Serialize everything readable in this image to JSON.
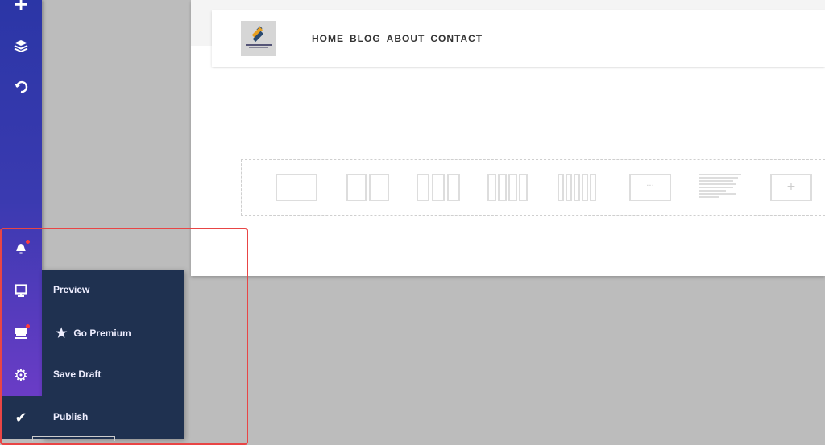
{
  "sidebar": {
    "icons": [
      "plus-icon",
      "layers-icon",
      "undo-icon",
      "bell-icon",
      "monitor-icon",
      "store-icon",
      "gear-icon",
      "check-icon"
    ]
  },
  "header": {
    "nav": [
      "HOME",
      "BLOG",
      "ABOUT",
      "CONTACT"
    ]
  },
  "layouts": [
    "1-column",
    "2-columns",
    "3-columns",
    "4-columns",
    "5-columns",
    "custom",
    "text",
    "add"
  ],
  "layout_labels": {
    "custom": "···",
    "add": "+"
  },
  "menu": {
    "preview": "Preview",
    "premium": "Go Premium",
    "save": "Save Draft",
    "publish": "Publish"
  },
  "colors": {
    "sidebar_top": "#2b36a6",
    "sidebar_bottom": "#6a3cc6",
    "menu_bg": "#1f3150",
    "notification": "#ff3b3b",
    "highlight": "#e84545"
  }
}
